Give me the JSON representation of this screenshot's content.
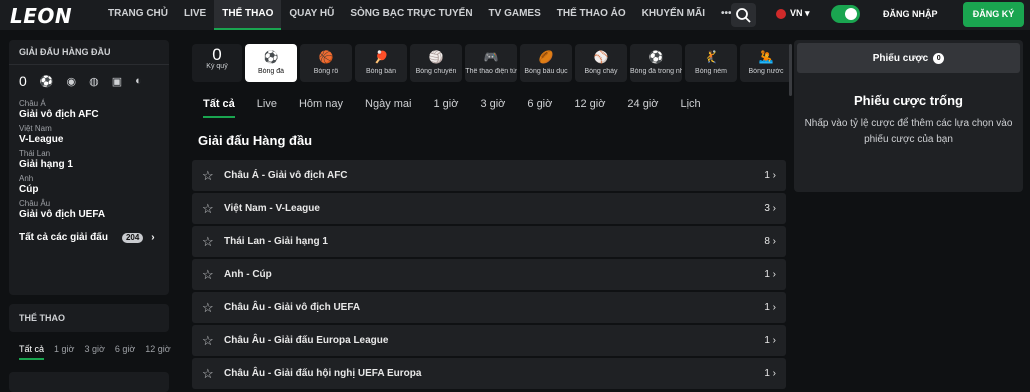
{
  "logo": "LEON",
  "nav": [
    "TRANG CHỦ",
    "LIVE",
    "THỂ THAO",
    "QUAY HŨ",
    "SÒNG BẠC TRỰC TUYẾN",
    "TV GAMES",
    "THỂ THAO ẢO",
    "KHUYẾN MÃI"
  ],
  "nav_more": "•••",
  "lang": "VN ▾",
  "login": "ĐĂNG NHẬP",
  "signup": "ĐĂNG KÝ",
  "left": {
    "top_title": "GIẢI ĐẤU HÀNG ĐẦU",
    "zero": "0",
    "leagues": [
      {
        "country": "Châu Á",
        "name": "Giải vô địch AFC"
      },
      {
        "country": "Việt Nam",
        "name": "V-League"
      },
      {
        "country": "Thái Lan",
        "name": "Giải hạng 1"
      },
      {
        "country": "Anh",
        "name": "Cúp"
      },
      {
        "country": "Châu Âu",
        "name": "Giải vô địch UEFA"
      }
    ],
    "all_label": "Tất cả các giải đấu",
    "all_count": "204",
    "sport_title": "THỂ THAO",
    "sport_tabs": [
      "Tất cả",
      "1 giờ",
      "3 giờ",
      "6 giờ",
      "12 giờ"
    ]
  },
  "sports": [
    {
      "label": "Kỳ quỹ",
      "icon": "0"
    },
    {
      "label": "Bóng đá",
      "icon": "⚽"
    },
    {
      "label": "Bóng rổ",
      "icon": "🏀"
    },
    {
      "label": "Bóng bàn",
      "icon": "🏓"
    },
    {
      "label": "Bóng chuyền",
      "icon": "🏐"
    },
    {
      "label": "Thể thao điện tử",
      "icon": "🎮"
    },
    {
      "label": "Bóng bầu dục",
      "icon": "🏉"
    },
    {
      "label": "Bóng chày",
      "icon": "⚾"
    },
    {
      "label": "Bóng đá trong nhà",
      "icon": "⚽"
    },
    {
      "label": "Bóng ném",
      "icon": "🤾"
    },
    {
      "label": "Bóng nước",
      "icon": "🤽"
    }
  ],
  "tabs": [
    "Tất cả",
    "Live",
    "Hôm nay",
    "Ngày mai",
    "1 giờ",
    "3 giờ",
    "6 giờ",
    "12 giờ",
    "24 giờ",
    "Lịch"
  ],
  "section_title": "Giải đấu Hàng đầu",
  "rows": [
    {
      "name": "Châu Á - Giải vô địch AFC",
      "count": "1 ›"
    },
    {
      "name": "Việt Nam - V-League",
      "count": "3 ›"
    },
    {
      "name": "Thái Lan - Giải hạng 1",
      "count": "8 ›"
    },
    {
      "name": "Anh - Cúp",
      "count": "1 ›"
    },
    {
      "name": "Châu Âu - Giải vô địch UEFA",
      "count": "1 ›"
    },
    {
      "name": "Châu Âu - Giải đấu Europa League",
      "count": "1 ›"
    },
    {
      "name": "Châu Âu - Giải đấu hội nghị UEFA Europa",
      "count": "1 ›"
    }
  ],
  "slip": {
    "tab": "Phiếu cược",
    "count": "0",
    "title": "Phiếu cược trống",
    "text": "Nhấp vào tỷ lệ cược để thêm các lựa chọn vào phiếu cược của bạn"
  },
  "colors": {
    "accent": "#1aa550",
    "bg": "#0f1113",
    "panel": "#1f2124"
  }
}
